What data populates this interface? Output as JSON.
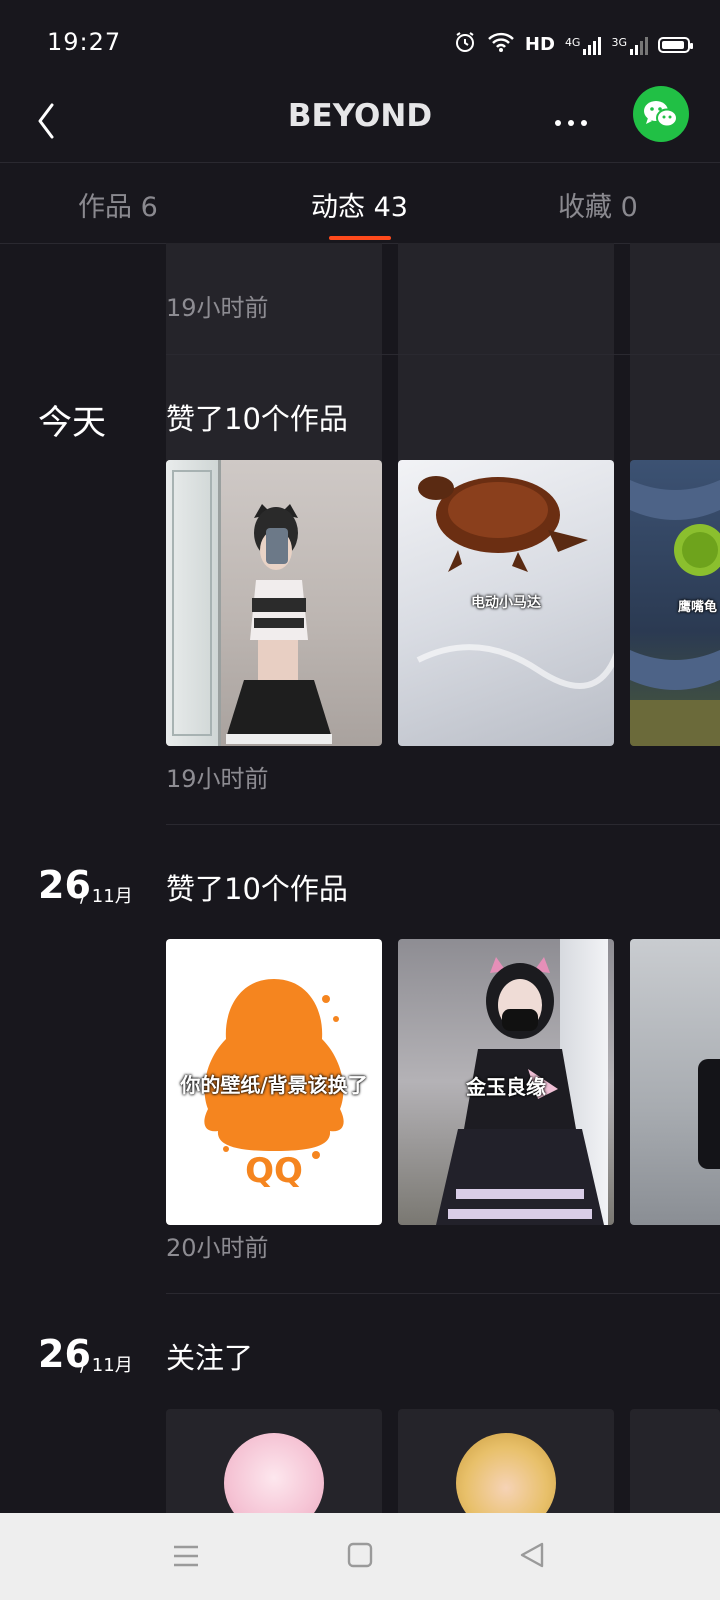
{
  "status_bar": {
    "time": "19:27",
    "network_label": "HD",
    "sim1_label": "4G",
    "sim2_label": "3G",
    "icons": [
      "alarm-icon",
      "wifi-icon",
      "signal-4g-icon",
      "signal-3g-icon",
      "battery-icon"
    ]
  },
  "header": {
    "title": "BEYOND",
    "icons": [
      "back-icon",
      "more-icon",
      "wechat-icon"
    ]
  },
  "tabs": [
    {
      "label": "作品 6",
      "active": false
    },
    {
      "label": "动态 43",
      "active": true
    },
    {
      "label": "收藏 0",
      "active": false
    }
  ],
  "feed": {
    "top_partial_timestamp": "19小时前",
    "items": [
      {
        "day_label": "今天",
        "action": "赞了10个作品",
        "timestamp": "19小时前",
        "thumbnails": [
          {
            "caption": ""
          },
          {
            "caption": "电动小马达"
          },
          {
            "caption": "鹰嘴龟"
          }
        ]
      },
      {
        "date_day": "26",
        "date_month": "/ 11月",
        "action": "赞了10个作品",
        "timestamp": "20小时前",
        "thumbnails": [
          {
            "caption": "你的壁纸/背景该换了",
            "logo_text": "QQ"
          },
          {
            "caption": "金玉良缘"
          },
          {
            "caption": ""
          }
        ]
      },
      {
        "date_day": "26",
        "date_month": "/ 11月",
        "action": "关注了"
      }
    ]
  },
  "colors": {
    "background": "#18171d",
    "accent": "#fe4a1c",
    "wechat": "#21c045",
    "muted_text": "#8d8c92"
  }
}
